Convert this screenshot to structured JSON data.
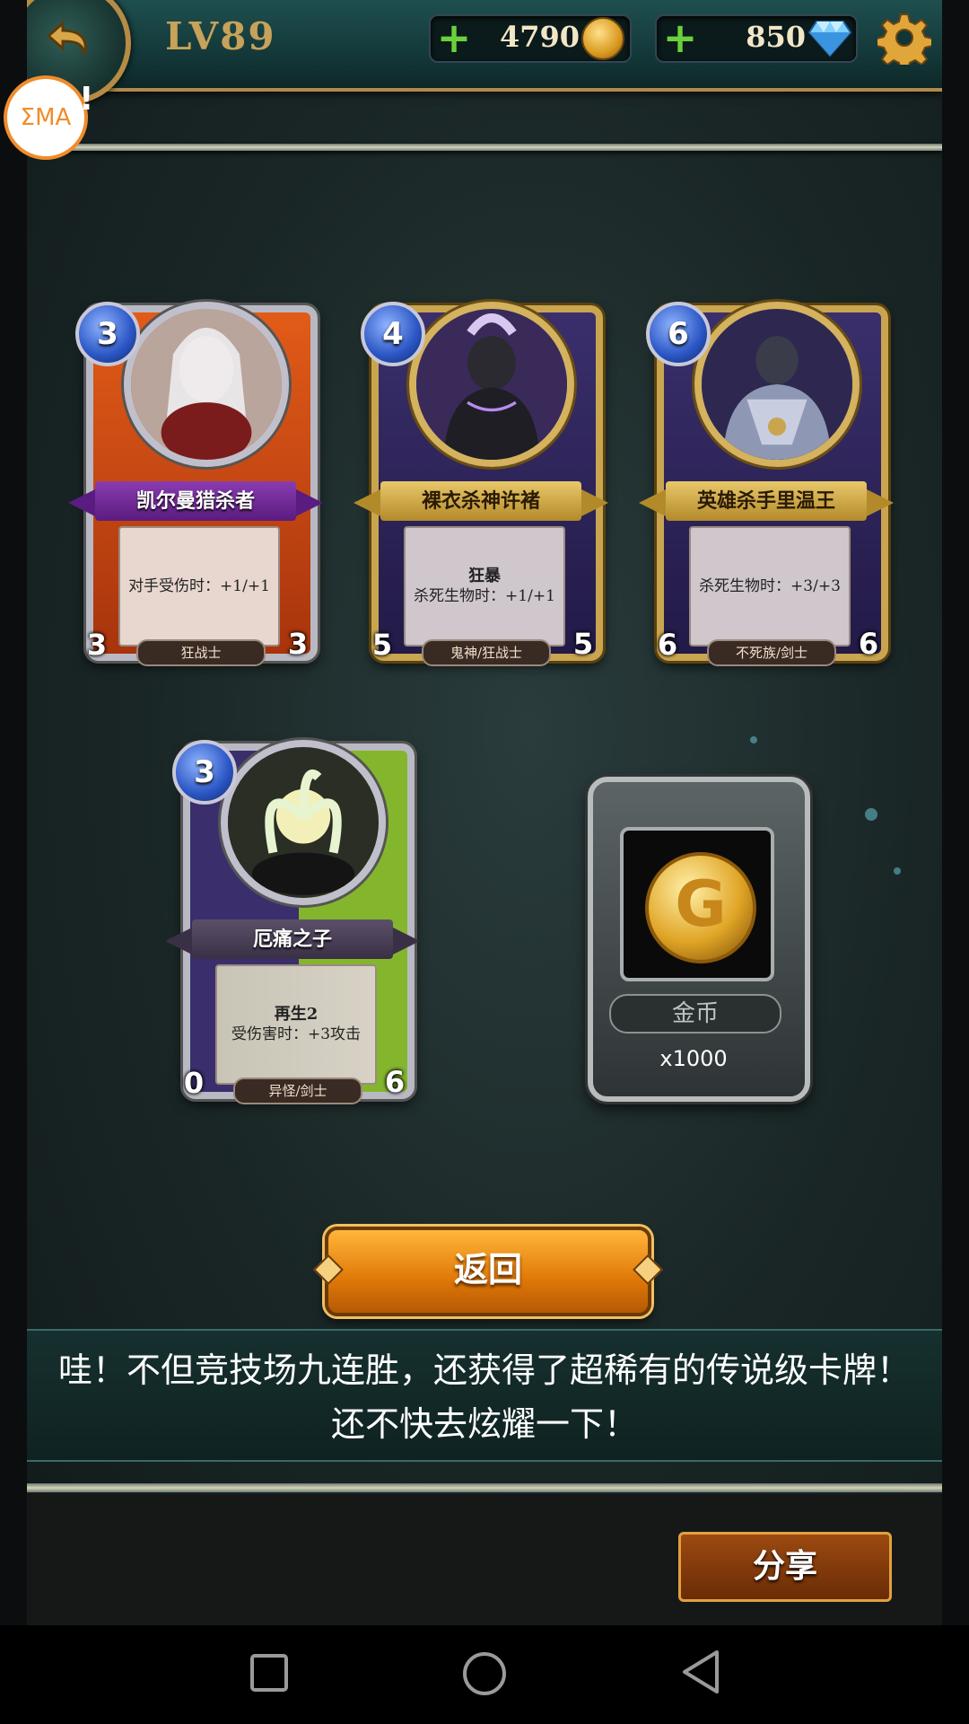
{
  "header": {
    "level": "LV89",
    "gold": "4790",
    "diamonds": "850"
  },
  "overlay": {
    "ema_label": "ΣMA",
    "ema_suffix": "!"
  },
  "cards": [
    {
      "mana": "3",
      "name": "凯尔曼猎杀者",
      "keyword": "",
      "effect": "对手受伤时：+1/+1",
      "attack": "3",
      "health": "3",
      "tribe": "狂战士"
    },
    {
      "mana": "4",
      "name": "裸衣杀神许褚",
      "keyword": "狂暴",
      "effect": "杀死生物时：+1/+1",
      "attack": "5",
      "health": "5",
      "tribe": "鬼神/狂战士"
    },
    {
      "mana": "6",
      "name": "英雄杀手里温王",
      "keyword": "",
      "effect": "杀死生物时：+3/+3",
      "attack": "6",
      "health": "6",
      "tribe": "不死族/剑士"
    },
    {
      "mana": "3",
      "name": "厄痛之子",
      "keyword": "再生2",
      "effect": "受伤害时：+3攻击",
      "attack": "0",
      "health": "6",
      "tribe": "异怪/剑士"
    }
  ],
  "reward": {
    "name": "金币",
    "quantity": "x1000"
  },
  "buttons": {
    "return_label": "返回",
    "share_label": "分享"
  },
  "message": {
    "line1": "哇！不但竞技场九连胜，还获得了超稀有的传说级卡牌！",
    "line2": "还不快去炫耀一下！"
  },
  "icons": {
    "back": "back-arrow-icon",
    "gold": "gold-coin-icon",
    "diamond": "diamond-icon",
    "settings": "gear-icon",
    "nav_recent": "square-icon",
    "nav_home": "circle-icon",
    "nav_back": "triangle-back-icon"
  },
  "colors": {
    "accent_gold": "#c7a25a",
    "button_orange": "#e07808",
    "plus_green": "#6bd13a"
  }
}
